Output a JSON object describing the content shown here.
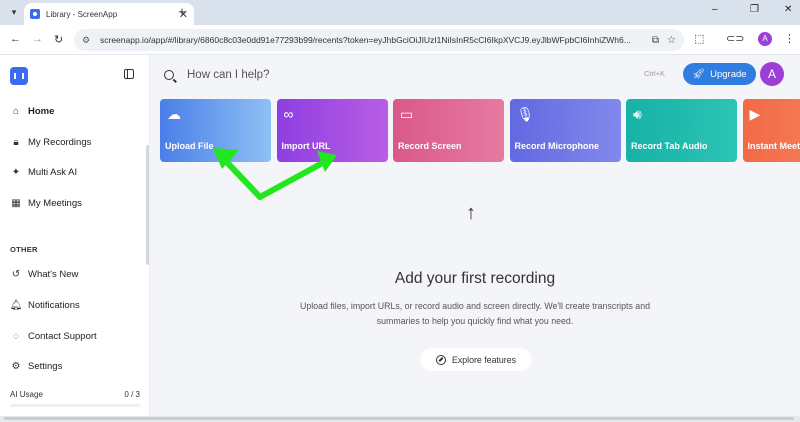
{
  "browser": {
    "tab_title": "Library - ScreenApp",
    "tab_close": "✕",
    "new_tab": "+",
    "url": "screenapp.io/app/#/library/6860c8c03e0dd91e77293b99/recents?token=eyJhbGciOiJIUzI1NiIsInR5cCI6IkpXVCJ9.eyJlbWFpbCI6InhiZWh6...",
    "profile_initial": "A",
    "window_controls": [
      "–",
      "❐",
      "✕"
    ]
  },
  "sidebar": {
    "items": [
      {
        "label": "Home",
        "icon": "home-icon"
      },
      {
        "label": "My Recordings",
        "icon": "lock-icon"
      },
      {
        "label": "Multi Ask AI",
        "icon": "sparkle-icon"
      },
      {
        "label": "My Meetings",
        "icon": "calendar-icon"
      }
    ],
    "section_other": "OTHER",
    "other_items": [
      {
        "label": "What's New",
        "icon": "history-icon"
      },
      {
        "label": "Notifications",
        "icon": "bell-icon"
      },
      {
        "label": "Contact Support",
        "icon": "chat-icon"
      },
      {
        "label": "Settings",
        "icon": "gear-icon"
      }
    ],
    "usage_label": "AI Usage",
    "usage_value": "0 / 3"
  },
  "header": {
    "search_placeholder": "How can I help?",
    "shortcut": "Ctrl+K",
    "upgrade_label": "Upgrade",
    "avatar_initial": "A"
  },
  "cards": [
    {
      "label": "Upload File",
      "icon": "cloud-upload-icon",
      "color_from": "#4a7ee8",
      "color_to": "#8fc0f5"
    },
    {
      "label": "Import URL",
      "icon": "link-icon",
      "color_from": "#8e3ee0",
      "color_to": "#b85ee6"
    },
    {
      "label": "Record Screen",
      "icon": "monitor-icon",
      "color_from": "#d9588a",
      "color_to": "#e67aa0"
    },
    {
      "label": "Record Microphone",
      "icon": "microphone-icon",
      "color_from": "#6268e0",
      "color_to": "#8289ec"
    },
    {
      "label": "Record Tab Audio",
      "icon": "speaker-icon",
      "color_from": "#16b2a6",
      "color_to": "#2cc4b5"
    },
    {
      "label": "Instant Meeting",
      "icon": "video-icon",
      "color_from": "#f26a45",
      "color_to": "#f4855e"
    }
  ],
  "empty_state": {
    "title": "Add your first recording",
    "description": "Upload files, import URLs, or record audio and screen directly. We'll create transcripts and summaries to help you quickly find what you need.",
    "explore_label": "Explore features"
  },
  "annotation": {
    "color": "#22e61e"
  }
}
